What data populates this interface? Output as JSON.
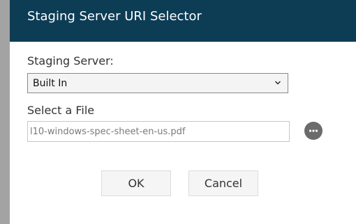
{
  "dialog": {
    "title": "Staging Server URI Selector"
  },
  "staging_server": {
    "label": "Staging Server:",
    "selected": "Built In"
  },
  "file": {
    "label": "Select a File",
    "value": "l10-windows-spec-sheet-en-us.pdf"
  },
  "buttons": {
    "ok": "OK",
    "cancel": "Cancel"
  },
  "icons": {
    "dropdown": "chevron-down-icon",
    "browse": "more-horizontal-icon"
  },
  "colors": {
    "titlebar": "#0d3c55",
    "browse_button": "#6b6b6b"
  }
}
